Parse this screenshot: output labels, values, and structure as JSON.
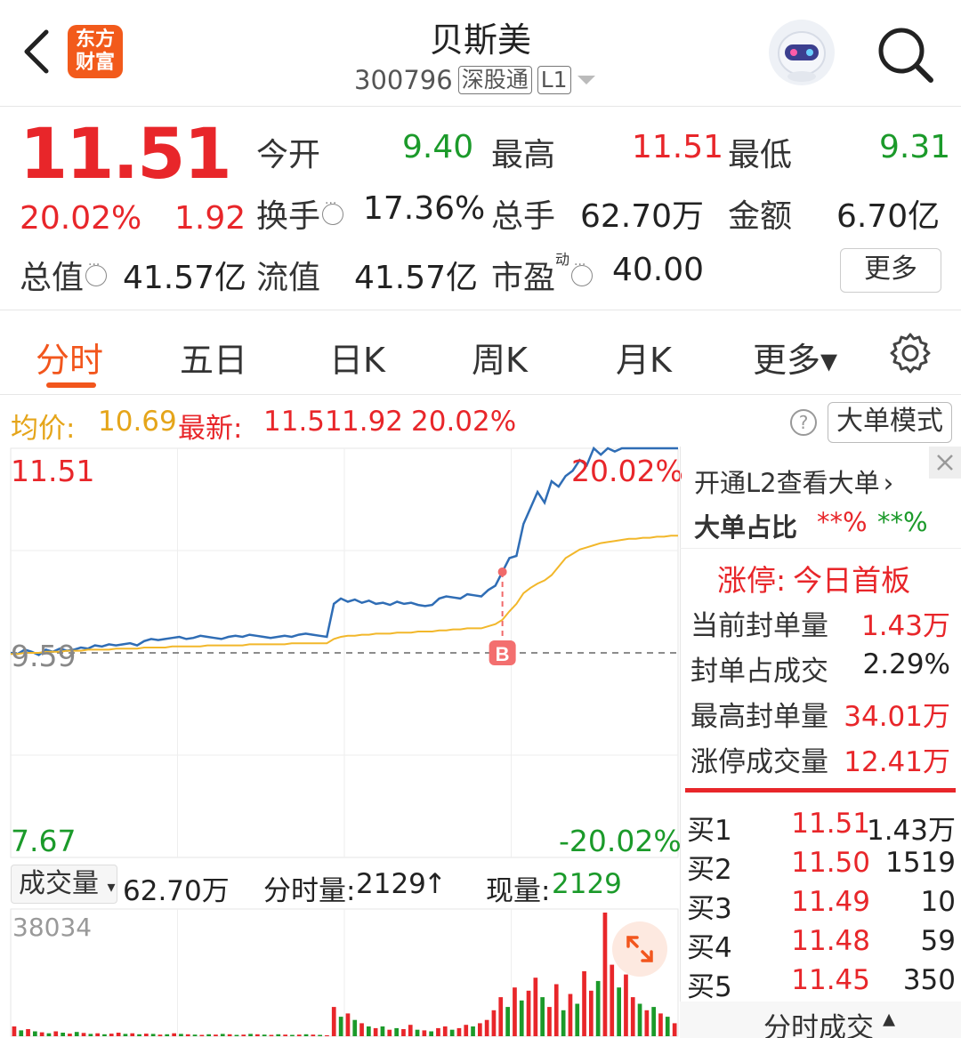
{
  "header": {
    "title": "贝斯美",
    "code": "300796",
    "tag_connect": "深股通",
    "tag_level": "L1",
    "logo_line1": "东方",
    "logo_line2": "财富"
  },
  "quote": {
    "price": "11.51",
    "change_pct": "20.02%",
    "change_abs": "1.92",
    "open_label": "今开",
    "open": "9.40",
    "high_label": "最高",
    "high": "11.51",
    "low_label": "最低",
    "low": "9.31",
    "turnover_label": "换手",
    "turnover": "17.36%",
    "volume_label": "总手",
    "volume": "62.70万",
    "amount_label": "金额",
    "amount": "6.70亿",
    "mktcap_label": "总值",
    "mktcap": "41.57亿",
    "float_label": "流值",
    "float_cap": "41.57亿",
    "pe_label": "市盈",
    "pe_sup": "动",
    "pe": "40.00",
    "more_label": "更多"
  },
  "tabs": [
    {
      "label": "分时",
      "active": true
    },
    {
      "label": "五日"
    },
    {
      "label": "日K"
    },
    {
      "label": "周K"
    },
    {
      "label": "月K"
    },
    {
      "label": "更多▾"
    }
  ],
  "avgbar": {
    "avg_label": "均价:",
    "avg_value": "10.69",
    "latest_label": "最新:",
    "latest_value": "11.51",
    "change_abs": "1.92",
    "change_pct": "20.02%",
    "help": "?",
    "bigmode_label": "大单模式"
  },
  "chart": {
    "y_top": "11.51",
    "y_mid": "9.59",
    "y_bottom": "7.67",
    "pct_top": "20.02%",
    "pct_bottom": "-20.02%",
    "buy_marker": "B",
    "colors": {
      "price": "#2f6db5",
      "avg": "#f2b72a",
      "up": "#e8262a",
      "down": "#1b9a2a"
    }
  },
  "chart_data": {
    "type": "line",
    "ylim": [
      7.67,
      11.51
    ],
    "reference_price": 9.59,
    "series": [
      {
        "name": "",
        "values": [
          9.59,
          9.58,
          9.62,
          9.6,
          9.57,
          9.62,
          9.6,
          9.63,
          9.61,
          9.62,
          9.64,
          9.63,
          9.66,
          9.65,
          9.67,
          9.66,
          9.67,
          9.68,
          9.66,
          9.7,
          9.72,
          9.71,
          9.72,
          9.73,
          9.74,
          9.72,
          9.73,
          9.75,
          9.74,
          9.73,
          9.72,
          9.74,
          9.75,
          9.74,
          9.76,
          9.75,
          9.74,
          9.73,
          9.74,
          9.75,
          9.74,
          9.76,
          9.77,
          9.76,
          9.75,
          9.74,
          10.05,
          10.1,
          10.07,
          10.09,
          10.06,
          10.08,
          10.05,
          10.06,
          10.04,
          10.07,
          10.05,
          10.06,
          10.04,
          10.03,
          10.04,
          10.1,
          10.12,
          10.11,
          10.1,
          10.14,
          10.13,
          10.12,
          10.18,
          10.22,
          10.35,
          10.48,
          10.5,
          10.8,
          10.95,
          11.1,
          11.0,
          11.2,
          11.15,
          11.25,
          11.3,
          11.4,
          11.35,
          11.51,
          11.45,
          11.51,
          11.48,
          11.51,
          11.51,
          11.51,
          11.51,
          11.51,
          11.51,
          11.51,
          11.51,
          11.51
        ]
      },
      {
        "name": "",
        "values": [
          9.58,
          9.58,
          9.59,
          9.59,
          9.59,
          9.6,
          9.6,
          9.6,
          9.61,
          9.61,
          9.61,
          9.62,
          9.62,
          9.62,
          9.62,
          9.63,
          9.63,
          9.63,
          9.63,
          9.64,
          9.64,
          9.64,
          9.64,
          9.65,
          9.65,
          9.65,
          9.65,
          9.65,
          9.66,
          9.66,
          9.66,
          9.66,
          9.66,
          9.66,
          9.67,
          9.67,
          9.67,
          9.67,
          9.67,
          9.67,
          9.68,
          9.68,
          9.68,
          9.68,
          9.68,
          9.68,
          9.72,
          9.74,
          9.75,
          9.75,
          9.76,
          9.76,
          9.77,
          9.77,
          9.77,
          9.78,
          9.78,
          9.78,
          9.79,
          9.79,
          9.79,
          9.8,
          9.8,
          9.81,
          9.81,
          9.82,
          9.82,
          9.82,
          9.84,
          9.86,
          9.9,
          9.98,
          10.05,
          10.15,
          10.2,
          10.24,
          10.27,
          10.32,
          10.4,
          10.48,
          10.52,
          10.56,
          10.58,
          10.6,
          10.62,
          10.63,
          10.64,
          10.65,
          10.66,
          10.66,
          10.67,
          10.67,
          10.68,
          10.68,
          10.69,
          10.69
        ]
      }
    ],
    "buy_point_index": 70
  },
  "volume": {
    "selector_label": "成交量",
    "total": "62.70万",
    "tick_label": "分时量:",
    "tick_value": "2129",
    "tick_arrow": "↑",
    "now_label": "现量:",
    "now_value": "2129",
    "ymax": "38034"
  },
  "volume_data": {
    "type": "bar",
    "ylim": [
      0,
      38034
    ],
    "values": [
      3000,
      1800,
      2200,
      1500,
      1200,
      900,
      1500,
      1100,
      800,
      1300,
      1000,
      700,
      900,
      600,
      800,
      1100,
      700,
      900,
      600,
      800,
      700,
      500,
      600,
      900,
      700,
      600,
      500,
      400,
      600,
      500,
      700,
      600,
      400,
      500,
      700,
      600,
      500,
      400,
      600,
      500,
      400,
      500,
      600,
      500,
      400,
      300,
      9000,
      6000,
      7000,
      5000,
      4000,
      3000,
      2500,
      3000,
      2000,
      2500,
      2200,
      3500,
      2000,
      1800,
      1500,
      2500,
      3000,
      2000,
      2500,
      3500,
      3000,
      4000,
      5000,
      8000,
      12000,
      9000,
      15000,
      11000,
      14000,
      18000,
      12000,
      9000,
      16000,
      8000,
      13000,
      10000,
      20000,
      14000,
      17000,
      38034,
      22000,
      15000,
      19000,
      12000,
      10000,
      8000,
      9000,
      7000,
      6000,
      4000
    ],
    "up_flags": [
      1,
      0,
      1,
      0,
      1,
      0,
      1,
      0,
      1,
      0,
      1,
      0,
      1,
      0,
      1,
      1,
      0,
      1,
      0,
      1,
      0,
      1,
      0,
      1,
      0,
      1,
      0,
      1,
      0,
      1,
      0,
      1,
      0,
      1,
      0,
      1,
      0,
      1,
      0,
      1,
      0,
      1,
      0,
      1,
      0,
      1,
      1,
      0,
      1,
      0,
      1,
      0,
      1,
      0,
      1,
      0,
      1,
      1,
      0,
      1,
      0,
      1,
      1,
      0,
      1,
      1,
      0,
      1,
      1,
      1,
      1,
      0,
      1,
      0,
      1,
      1,
      0,
      1,
      1,
      0,
      1,
      0,
      1,
      1,
      0,
      1,
      1,
      0,
      1,
      1,
      0,
      1,
      0,
      1,
      0,
      1
    ]
  },
  "right_panel": {
    "open_l2": "开通L2查看大单",
    "chevron": "›",
    "big_order_label": "大单占比",
    "big_order_red": "**%",
    "big_order_green": "**%",
    "limit_label": "涨停:",
    "limit_value": "今日首板",
    "rows": [
      {
        "label": "当前封单量",
        "value": "1.43万",
        "color": "red"
      },
      {
        "label": "封单占成交",
        "value": "2.29%",
        "color": "black"
      },
      {
        "label": "最高封单量",
        "value": "34.01万",
        "color": "red"
      },
      {
        "label": "涨停成交量",
        "value": "12.41万",
        "color": "red"
      }
    ],
    "book": [
      {
        "label": "买1",
        "price": "11.51",
        "qty": "1.43万"
      },
      {
        "label": "买2",
        "price": "11.50",
        "qty": "1519"
      },
      {
        "label": "买3",
        "price": "11.49",
        "qty": "10"
      },
      {
        "label": "买4",
        "price": "11.48",
        "qty": "59"
      },
      {
        "label": "买5",
        "price": "11.45",
        "qty": "350"
      }
    ],
    "trades_label": "分时成交",
    "trades_arrow": "▴"
  }
}
